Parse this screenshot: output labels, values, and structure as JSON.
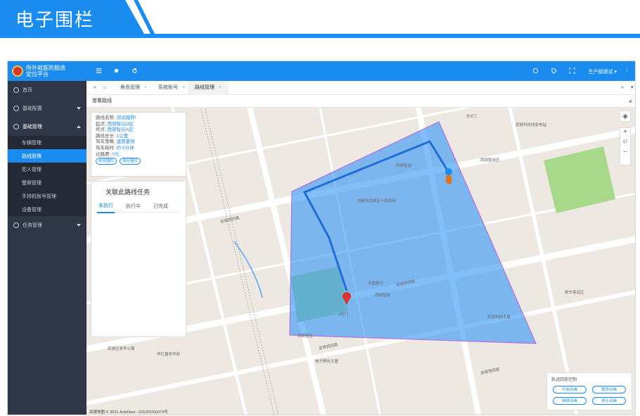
{
  "banner": {
    "title": "电子围栏"
  },
  "app": {
    "name": "所外就医防脱逃定位平台",
    "name_line1": "所外就医防脱逃",
    "name_line2": "定位平台",
    "user": "生产部测试"
  },
  "sidebar": {
    "items": [
      {
        "label": "首页",
        "icon": "home-icon"
      },
      {
        "label": "基础配置",
        "icon": "settings-icon"
      },
      {
        "label": "基础管理",
        "icon": "settings-icon"
      },
      {
        "label": "任务管理",
        "icon": "settings-icon"
      }
    ],
    "sub_items": [
      "车辆管理",
      "路线管理",
      "犯人管理",
      "警察管理",
      "手持机账号管理",
      "设备管理"
    ],
    "active_sub": "路线管理"
  },
  "tabs": [
    {
      "label": "角色管理"
    },
    {
      "label": "系统账号"
    },
    {
      "label": "路线管理"
    }
  ],
  "subhead": {
    "title": "查看路线"
  },
  "route_info": {
    "name_label": "路线名称:",
    "name_value": "测试越界!",
    "start_label": "起点:",
    "start_value": "西部智谷D区",
    "end_label": "终点:",
    "end_value": "西部智谷A区",
    "length_label": "路线总长:",
    "length_value": "1公里",
    "strategy_label": "驾车策略:",
    "strategy_value": "速度最快",
    "time_label": "驾车耗时:",
    "time_value": "约 5分钟",
    "toll_label": "过路费:",
    "toll_value": "0元",
    "btn_edit": "修改围栏",
    "btn_save": "保存围栏"
  },
  "task_panel": {
    "title": "关联此路线任务",
    "tabs": [
      "未执行",
      "执行中",
      "已完成"
    ]
  },
  "map": {
    "labels": [
      "东3门",
      "武侯科技线变电站",
      "成都市武侯区人民政府",
      "西部智谷区",
      "武侯西四路",
      "武侯西四路",
      "武侯西四路",
      "武青西四路",
      "西部智谷",
      "西部智谷",
      "中国银行",
      "2号门",
      "安全科技大厦",
      "新东客运区",
      "西部智谷",
      "电子孵化大厦",
      "武侯西四路",
      "华亿嘉年华府",
      "武侯区老年公寓",
      "西部智谷"
    ],
    "zoom": "17",
    "attribution": "高德地图 © 2021 AutoNavi - GS(2019)6379号"
  },
  "playback": {
    "title": "轨迹回放控制",
    "start": "开始动画",
    "pause": "暂停动画",
    "resume": "继续动画",
    "stop": "停止动画"
  },
  "colors": {
    "primary": "#1a8cf0",
    "sidebar": "#2f3747",
    "fence": "#3f9bf5"
  }
}
